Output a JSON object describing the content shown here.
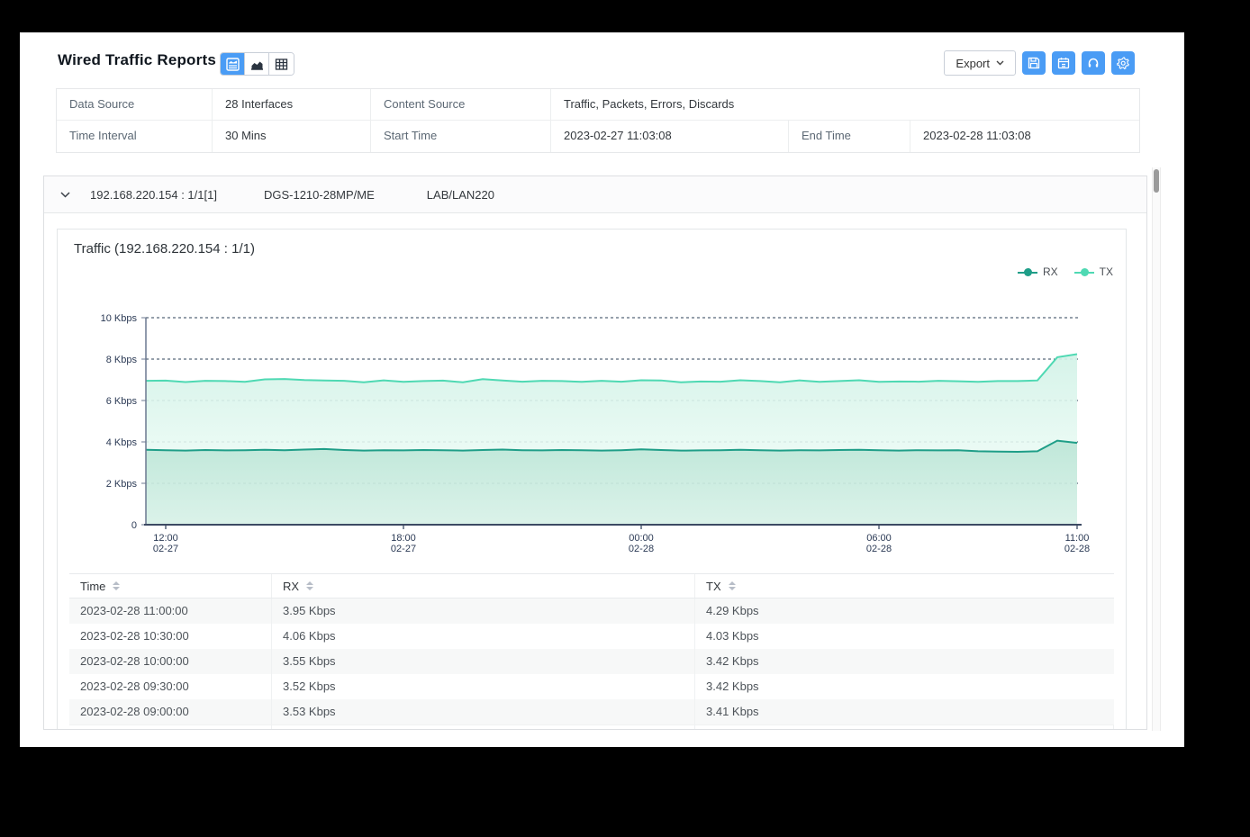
{
  "header": {
    "title": "Wired Traffic Reports",
    "export_label": "Export"
  },
  "view_toggle": {
    "selected": "combined-view",
    "options": [
      "combined-view",
      "chart-view",
      "table-view"
    ]
  },
  "toolbar_icons": [
    "save",
    "schedule",
    "headset",
    "settings"
  ],
  "colors": {
    "accent_blue": "#4a9cf5",
    "rx": "#1f9e88",
    "tx": "#4fd9b3",
    "grid": "#2e4057",
    "axis": "#3c4a63"
  },
  "summary": {
    "data_source_label": "Data Source",
    "data_source_value": "28 Interfaces",
    "content_source_label": "Content Source",
    "content_source_value": "Traffic, Packets, Errors, Discards",
    "time_interval_label": "Time Interval",
    "time_interval_value": "30 Mins",
    "start_time_label": "Start Time",
    "start_time_value": "2023-02-27 11:03:08",
    "end_time_label": "End Time",
    "end_time_value": "2023-02-28 11:03:08"
  },
  "device": {
    "ip_port": "192.168.220.154 : 1/1[1]",
    "model": "DGS-1210-28MP/ME",
    "site": "LAB/LAN220"
  },
  "chart_data": {
    "type": "area",
    "stacked": true,
    "title": "Traffic (192.168.220.154 : 1/1)",
    "unit": "Kbps",
    "ylim": [
      0,
      10
    ],
    "yticks": [
      {
        "v": 0,
        "label": "0"
      },
      {
        "v": 2,
        "label": "2 Kbps"
      },
      {
        "v": 4,
        "label": "4 Kbps"
      },
      {
        "v": 6,
        "label": "6 Kbps"
      },
      {
        "v": 8,
        "label": "8 Kbps"
      },
      {
        "v": 10,
        "label": "10 Kbps"
      }
    ],
    "xticks": [
      {
        "i": 1,
        "time": "12:00",
        "date": "02-27"
      },
      {
        "i": 13,
        "time": "18:00",
        "date": "02-27"
      },
      {
        "i": 25,
        "time": "00:00",
        "date": "02-28"
      },
      {
        "i": 37,
        "time": "06:00",
        "date": "02-28"
      },
      {
        "i": 47,
        "time": "11:00",
        "date": "02-28"
      }
    ],
    "interval_mins": 30,
    "grid": "dashed",
    "legend_position": "top-right",
    "series": [
      {
        "name": "RX",
        "color": "#1f9e88",
        "values": [
          3.62,
          3.6,
          3.58,
          3.61,
          3.59,
          3.6,
          3.62,
          3.6,
          3.63,
          3.66,
          3.61,
          3.58,
          3.6,
          3.59,
          3.61,
          3.6,
          3.58,
          3.61,
          3.63,
          3.6,
          3.59,
          3.61,
          3.6,
          3.58,
          3.6,
          3.64,
          3.61,
          3.58,
          3.59,
          3.6,
          3.62,
          3.6,
          3.58,
          3.6,
          3.59,
          3.61,
          3.62,
          3.6,
          3.58,
          3.6,
          3.59,
          3.6,
          3.55,
          3.53,
          3.52,
          3.55,
          4.06,
          3.95
        ]
      },
      {
        "name": "TX",
        "color": "#4fd9b3",
        "values": [
          3.33,
          3.36,
          3.31,
          3.34,
          3.35,
          3.3,
          3.4,
          3.44,
          3.36,
          3.31,
          3.34,
          3.3,
          3.37,
          3.31,
          3.33,
          3.36,
          3.3,
          3.42,
          3.34,
          3.31,
          3.36,
          3.33,
          3.3,
          3.37,
          3.31,
          3.34,
          3.36,
          3.3,
          3.33,
          3.31,
          3.36,
          3.34,
          3.3,
          3.37,
          3.31,
          3.33,
          3.36,
          3.3,
          3.34,
          3.31,
          3.36,
          3.33,
          3.35,
          3.41,
          3.42,
          3.42,
          4.03,
          4.29
        ]
      }
    ]
  },
  "table": {
    "columns": [
      "Time",
      "RX",
      "TX"
    ],
    "rows": [
      {
        "time": "2023-02-28 11:00:00",
        "rx": "3.95 Kbps",
        "tx": "4.29 Kbps"
      },
      {
        "time": "2023-02-28 10:30:00",
        "rx": "4.06 Kbps",
        "tx": "4.03 Kbps"
      },
      {
        "time": "2023-02-28 10:00:00",
        "rx": "3.55 Kbps",
        "tx": "3.42 Kbps"
      },
      {
        "time": "2023-02-28 09:30:00",
        "rx": "3.52 Kbps",
        "tx": "3.42 Kbps"
      },
      {
        "time": "2023-02-28 09:00:00",
        "rx": "3.53 Kbps",
        "tx": "3.41 Kbps"
      }
    ]
  }
}
